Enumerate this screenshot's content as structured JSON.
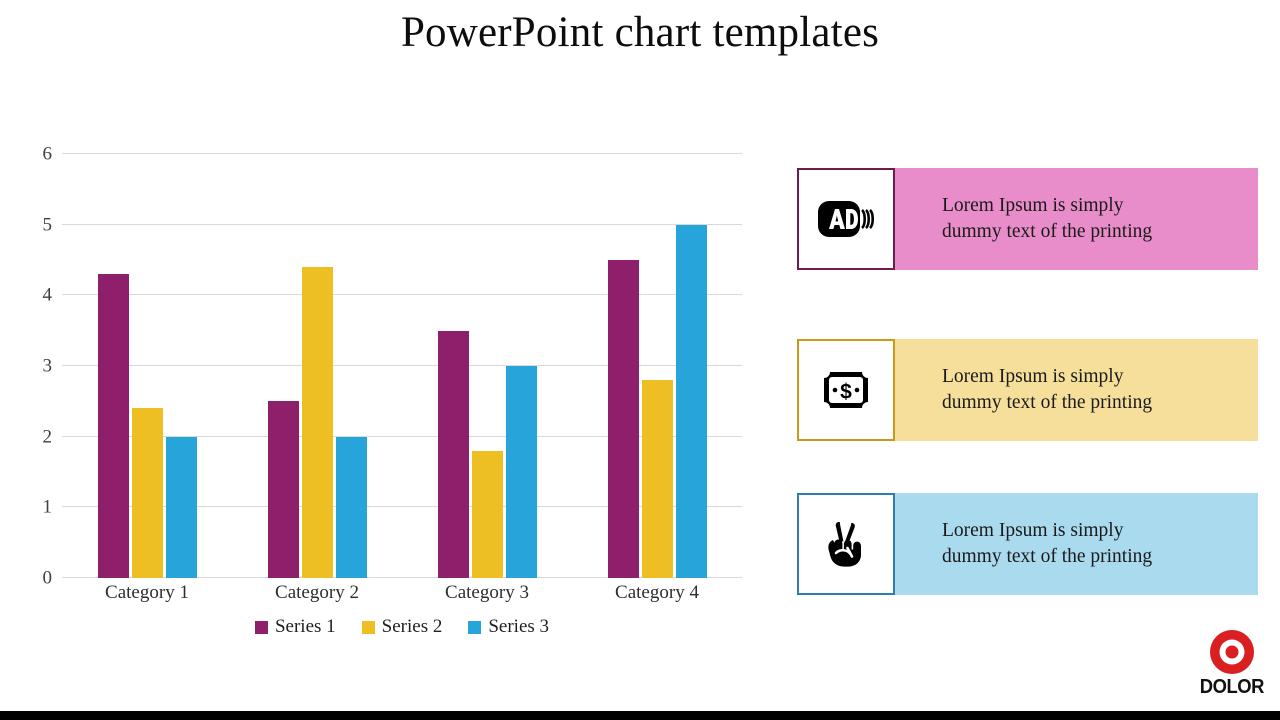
{
  "slide": {
    "title": "PowerPoint chart templates",
    "background": "#ffffff",
    "bottom_bar_color": "#000000"
  },
  "chart_data": {
    "type": "bar",
    "title": "",
    "xlabel": "",
    "ylabel": "",
    "ylim": [
      0,
      6
    ],
    "yticks": [
      0,
      1,
      2,
      3,
      4,
      5,
      6
    ],
    "grid": true,
    "legend_position": "bottom",
    "categories": [
      "Category 1",
      "Category 2",
      "Category 3",
      "Category 4"
    ],
    "series": [
      {
        "name": "Series 1",
        "color": "#8e1f6b",
        "values": [
          4.3,
          2.5,
          3.5,
          4.5
        ]
      },
      {
        "name": "Series 2",
        "color": "#edbf22",
        "values": [
          2.4,
          4.4,
          1.8,
          2.8
        ]
      },
      {
        "name": "Series 3",
        "color": "#27a4d9",
        "values": [
          2.0,
          2.0,
          3.0,
          5.0
        ]
      }
    ]
  },
  "cards": [
    {
      "icon": "audio-description-icon",
      "text": "Lorem Ipsum is simply\ndummy text of the printing",
      "fill": "#e88dc9",
      "border": "#6e1b52"
    },
    {
      "icon": "money-banknote-icon",
      "text": "Lorem Ipsum is simply\ndummy text of the printing",
      "fill": "#f5df9b",
      "border": "#c9991a"
    },
    {
      "icon": "peace-hand-icon",
      "text": "Lorem Ipsum is simply\ndummy text of the printing",
      "fill": "#a9daee",
      "border": "#2d7ea8"
    }
  ],
  "logo": {
    "wordmark": "DOLOR",
    "mark": "bullseye-target-icon",
    "color": "#d91f1f"
  }
}
